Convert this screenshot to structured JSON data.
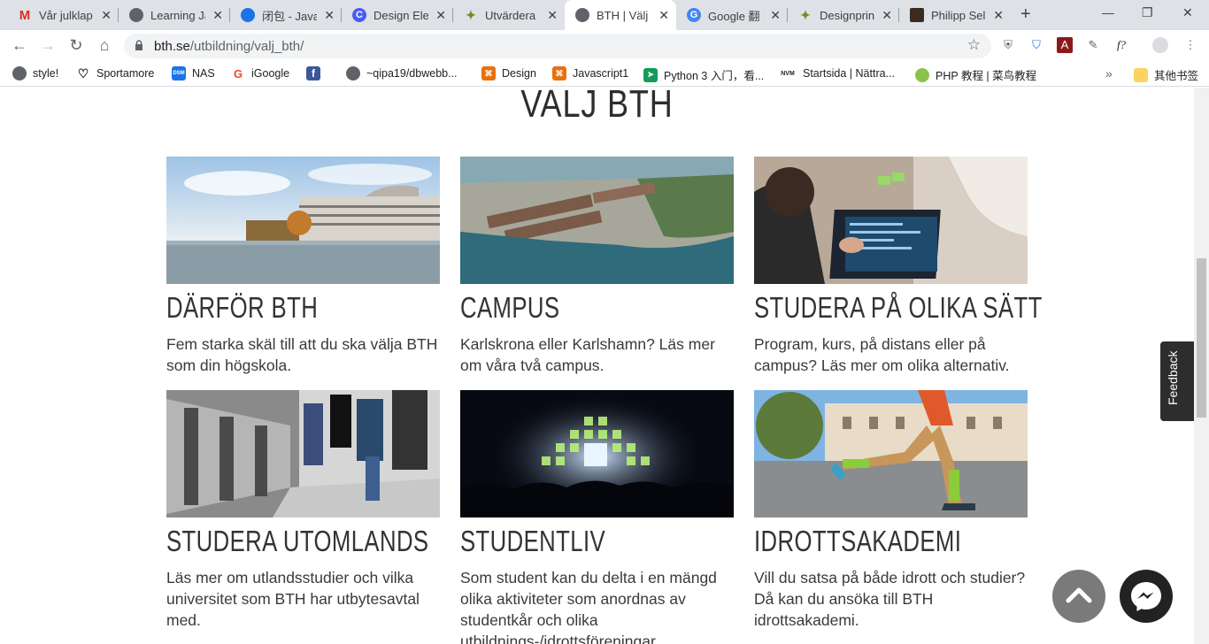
{
  "browser": {
    "tabs": [
      {
        "title": "Vår julklap",
        "favicon": "gmail-icon",
        "color": "#d93025",
        "glyph": "M"
      },
      {
        "title": "Learning Ja",
        "favicon": "globe-icon",
        "color": "#5f6368",
        "glyph": "◉"
      },
      {
        "title": "闭包 - Java",
        "favicon": "tutorial-icon",
        "color": "#1a73e8",
        "glyph": "◆"
      },
      {
        "title": "Design Ele",
        "favicon": "c-icon",
        "color": "#4a5af5",
        "glyph": "C"
      },
      {
        "title": "Utvärdera",
        "favicon": "leaf-icon",
        "color": "#6b8e23",
        "glyph": "✦"
      },
      {
        "title": "BTH | Välj",
        "favicon": "bth-icon",
        "color": "#5f6368",
        "glyph": "◉"
      },
      {
        "title": "Google 翻",
        "favicon": "google-translate-icon",
        "color": "#4285f4",
        "glyph": "G"
      },
      {
        "title": "Designprin",
        "favicon": "leaf-icon",
        "color": "#6b8e23",
        "glyph": "✦"
      },
      {
        "title": "Philipp Sel",
        "favicon": "portrait-icon",
        "color": "#3b2a20",
        "glyph": "▲"
      }
    ],
    "active_tab": 5,
    "url_host": "bth.se",
    "url_path": "/utbildning/valj_bth/",
    "bookmarks": [
      {
        "label": "style!",
        "icon": "globe-icon",
        "color": "#5f6368",
        "glyph": "◉"
      },
      {
        "label": "Sportamore",
        "icon": "heart-icon",
        "color": "#202124",
        "glyph": "♡"
      },
      {
        "label": "NAS",
        "icon": "dsm-icon",
        "color": "#1a73e8",
        "glyph": "DSM"
      },
      {
        "label": "iGoogle",
        "icon": "google-icon",
        "color": "#ea4335",
        "glyph": "G"
      },
      {
        "label": "",
        "icon": "facebook-icon",
        "color": "#3b5998",
        "glyph": "f"
      },
      {
        "label": "~qipa19/dbwebb...",
        "icon": "globe-icon",
        "color": "#5f6368",
        "glyph": "◉"
      },
      {
        "label": "Design",
        "icon": "codepen-icon",
        "color": "#e8710a",
        "glyph": "⌘"
      },
      {
        "label": "Javascript1",
        "icon": "codepen-icon",
        "color": "#e8710a",
        "glyph": "⌘"
      },
      {
        "label": "Python 3 入门，看...",
        "icon": "send-icon",
        "color": "#0f9d58",
        "glyph": "➤"
      },
      {
        "label": "Startsida | Nättra...",
        "icon": "nvm-icon",
        "color": "#202124",
        "glyph": "NVM"
      },
      {
        "label": "PHP 教程 | 菜鸟教程",
        "icon": "runoob-icon",
        "color": "#8bc34a",
        "glyph": "◎"
      }
    ],
    "other_bookmarks": "其他书签"
  },
  "page": {
    "title": "VALJ BTH",
    "cards": [
      {
        "heading": "DÄRFÖR BTH",
        "text": "Fem starka skäl till att du ska välja BTH som din högskola.",
        "image": "campus-waterfront-photo"
      },
      {
        "heading": "CAMPUS",
        "text": "Karlskrona eller Karlshamn? Läs mer om våra två campus.",
        "image": "aerial-campus-photo"
      },
      {
        "heading": "STUDERA PÅ OLIKA SÄTT",
        "text": "Program, kurs, på distans eller på campus? Läs mer om olika alternativ.",
        "image": "laptop-coding-photo"
      },
      {
        "heading": "STUDERA UTOMLANDS",
        "text": "Läs mer om utlandsstudier och vilka universitet som BTH har utbytesavtal med.",
        "image": "train-platform-photo"
      },
      {
        "heading": "STUDENTLIV",
        "text": "Som student kan du delta i en mängd olika aktiviteter som anordnas av studentkår och olika utbildnings-/idrottsföreningar.",
        "image": "concert-photo"
      },
      {
        "heading": "IDROTTSAKADEMI",
        "text": "Vill du satsa på både idrott och studier? Då kan du ansöka till BTH idrottsakademi.",
        "image": "runner-photo"
      }
    ],
    "feedback_label": "Feedback"
  }
}
